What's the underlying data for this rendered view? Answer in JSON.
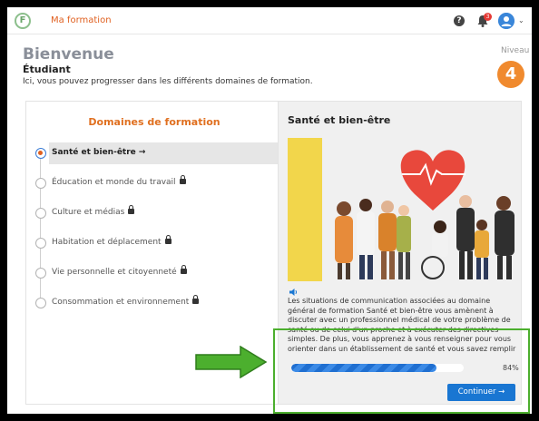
{
  "app": {
    "title": "Ma formation",
    "logo_letter": "F"
  },
  "topbar": {
    "help_glyph": "?",
    "notif_count": "3",
    "chevron": "⌄",
    "icons": [
      "help-icon",
      "bell-icon",
      "user-icon",
      "chevron-down-icon"
    ]
  },
  "header": {
    "welcome": "Bienvenue",
    "role": "Étudiant",
    "intro": "Ici, vous pouvez progresser dans les différents domaines de formation.",
    "niveau_label": "Niveau",
    "niveau_value": "4"
  },
  "domains": {
    "title": "Domaines de formation",
    "items": [
      {
        "label": "Santé et bien-être",
        "state": "active",
        "icon": "arrow-right-icon",
        "suffix": "→"
      },
      {
        "label": "Éducation et monde du travail",
        "state": "locked",
        "icon": "lock-icon"
      },
      {
        "label": "Culture et médias",
        "state": "locked",
        "icon": "lock-icon"
      },
      {
        "label": "Habitation et déplacement",
        "state": "locked",
        "icon": "lock-icon"
      },
      {
        "label": "Vie personnelle et citoyenneté",
        "state": "locked",
        "icon": "lock-icon"
      },
      {
        "label": "Consommation et environnement",
        "state": "locked",
        "icon": "lock-icon"
      }
    ]
  },
  "detail": {
    "title": "Santé et bien-être",
    "description": "Les situations de communication associées au domaine général de formation Santé et bien-être vous amènent à discuter avec un professionnel médical de votre problème de santé ou de celui d'un proche et à exécuter des directives simples. De plus, vous apprenez à vous renseigner pour vous orienter dans un établissement de santé et vous savez remplir un formulaire.",
    "progress_value": 84,
    "progress_text": "84%",
    "continue_label": "Continuer →"
  },
  "colors": {
    "accent_orange": "#e07020",
    "primary_blue": "#1976d2",
    "highlight_green": "#4caf2e",
    "panel_grey": "#f0f0f0"
  }
}
